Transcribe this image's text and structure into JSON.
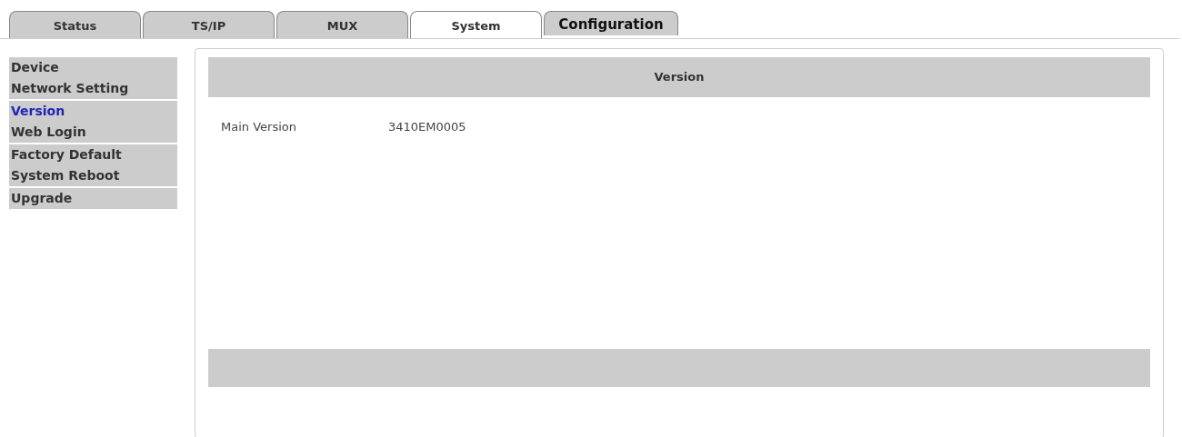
{
  "tabs": [
    {
      "label": "Status",
      "selected": false,
      "emphasized": false
    },
    {
      "label": "TS/IP",
      "selected": false,
      "emphasized": false
    },
    {
      "label": "MUX",
      "selected": false,
      "emphasized": false
    },
    {
      "label": "System",
      "selected": true,
      "emphasized": false
    },
    {
      "label": "Configuration",
      "selected": false,
      "emphasized": true
    }
  ],
  "sidebar": {
    "groups": [
      {
        "items": [
          {
            "label": "Device",
            "selected": false
          },
          {
            "label": "Network Setting",
            "selected": false
          }
        ]
      },
      {
        "items": [
          {
            "label": "Version",
            "selected": true
          },
          {
            "label": "Web Login",
            "selected": false
          }
        ]
      },
      {
        "items": [
          {
            "label": "Factory Default",
            "selected": false
          },
          {
            "label": "System Reboot",
            "selected": false
          }
        ]
      },
      {
        "items": [
          {
            "label": "Upgrade",
            "selected": false
          }
        ]
      }
    ]
  },
  "panel": {
    "title": "Version",
    "fields": [
      {
        "label": "Main Version",
        "value": "3410EM0005"
      }
    ]
  }
}
